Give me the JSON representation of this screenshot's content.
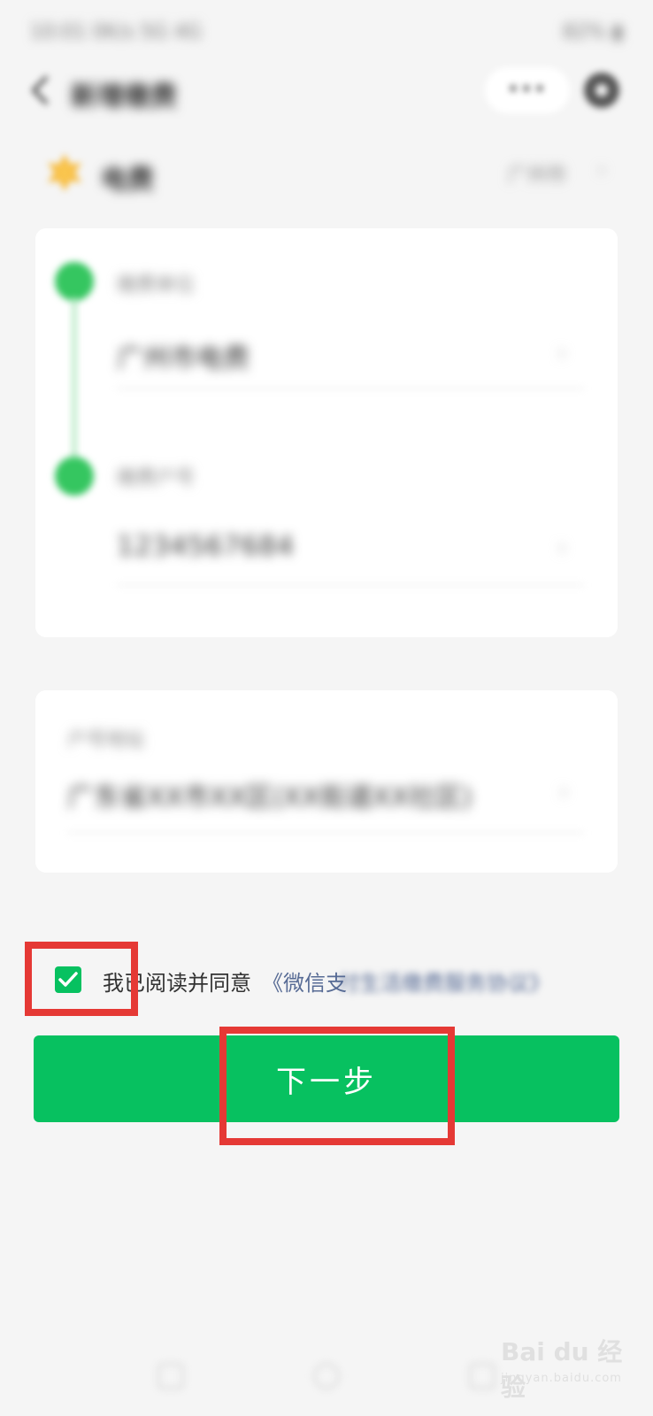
{
  "status_bar": {
    "left": "10:01 0K/s 5G 4G",
    "right": "82% ▮"
  },
  "header": {
    "title": "新增缴费",
    "more": "•••"
  },
  "provider": {
    "name": "电费",
    "region": "广州市",
    "chevron": "›"
  },
  "payment_form": {
    "unit_label": "缴费单位",
    "unit_value": "广州市电费",
    "account_label": "缴费户号",
    "account_value": "1234567684",
    "chevron": "›"
  },
  "address_card": {
    "label": "户号地址",
    "value": "广东省XX市XX区(XX街道XX社区)",
    "chevron": "›"
  },
  "agreement": {
    "checked": true,
    "text": "我已阅读并同意",
    "link_visible": "《微信支",
    "link_blurred": "付生活缴费服务协议》"
  },
  "next_button": {
    "label": "下一步"
  },
  "watermark": {
    "brand": "Bai du 经验",
    "url": "jingyan.baidu.com"
  },
  "colors": {
    "primary_green": "#07c160",
    "dot_green": "#35c660",
    "link_blue": "#576b95",
    "annotation_red": "#e53935",
    "background": "#f5f5f5"
  }
}
